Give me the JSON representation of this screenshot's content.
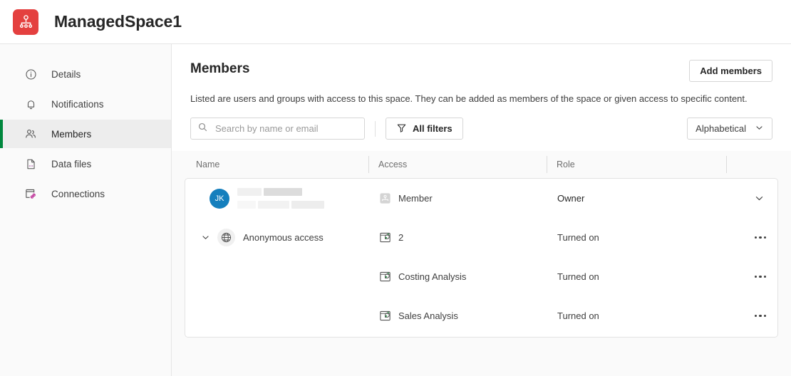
{
  "topbar": {
    "app_icon": "space-icon",
    "icon_color": "#e4403f",
    "title": "ManagedSpace1"
  },
  "sidebar": {
    "items": [
      {
        "label": "Details",
        "icon": "info-circle-icon",
        "active": false
      },
      {
        "label": "Notifications",
        "icon": "bell-icon",
        "active": false
      },
      {
        "label": "Members",
        "icon": "people-icon",
        "active": true
      },
      {
        "label": "Data files",
        "icon": "document-icon",
        "active": false
      },
      {
        "label": "Connections",
        "icon": "connections-icon",
        "active": false
      }
    ],
    "active_indicator_color": "#00873d"
  },
  "main": {
    "page_title": "Members",
    "description": "Listed are users and groups with access to this space. They can be added as members of the space or given access to specific content.",
    "add_members_label": "Add members"
  },
  "toolbar": {
    "search_placeholder": "Search by name or email",
    "search_value": "",
    "search_icon": "search-icon",
    "filters_label": "All filters",
    "filters_icon": "funnel-icon",
    "sort_label": "Alphabetical",
    "sort_icon": "chevron-down-icon"
  },
  "table": {
    "columns": [
      "Name",
      "Access",
      "Role",
      ""
    ],
    "rows": [
      {
        "type": "user",
        "avatar_initials": "JK",
        "avatar_color": "#157fbd",
        "name": "",
        "name_redacted": true,
        "access_icon": "space-member-icon",
        "access": "Member",
        "role": "Owner",
        "role_is_dropdown": true,
        "action": "chevron-down-icon"
      },
      {
        "type": "group",
        "expander": "chevron-down-icon",
        "name_icon": "globe-icon",
        "name": "Anonymous access",
        "access_icon": "app-icon",
        "access": "2",
        "role": "Turned on",
        "role_is_dropdown": false,
        "action": "more-options-icon"
      },
      {
        "type": "item",
        "name": "",
        "access_icon": "app-icon",
        "access": "Costing Analysis",
        "role": "Turned on",
        "role_is_dropdown": false,
        "action": "more-options-icon"
      },
      {
        "type": "item",
        "name": "",
        "access_icon": "app-icon",
        "access": "Sales Analysis",
        "role": "Turned on",
        "role_is_dropdown": false,
        "action": "more-options-icon"
      }
    ]
  }
}
